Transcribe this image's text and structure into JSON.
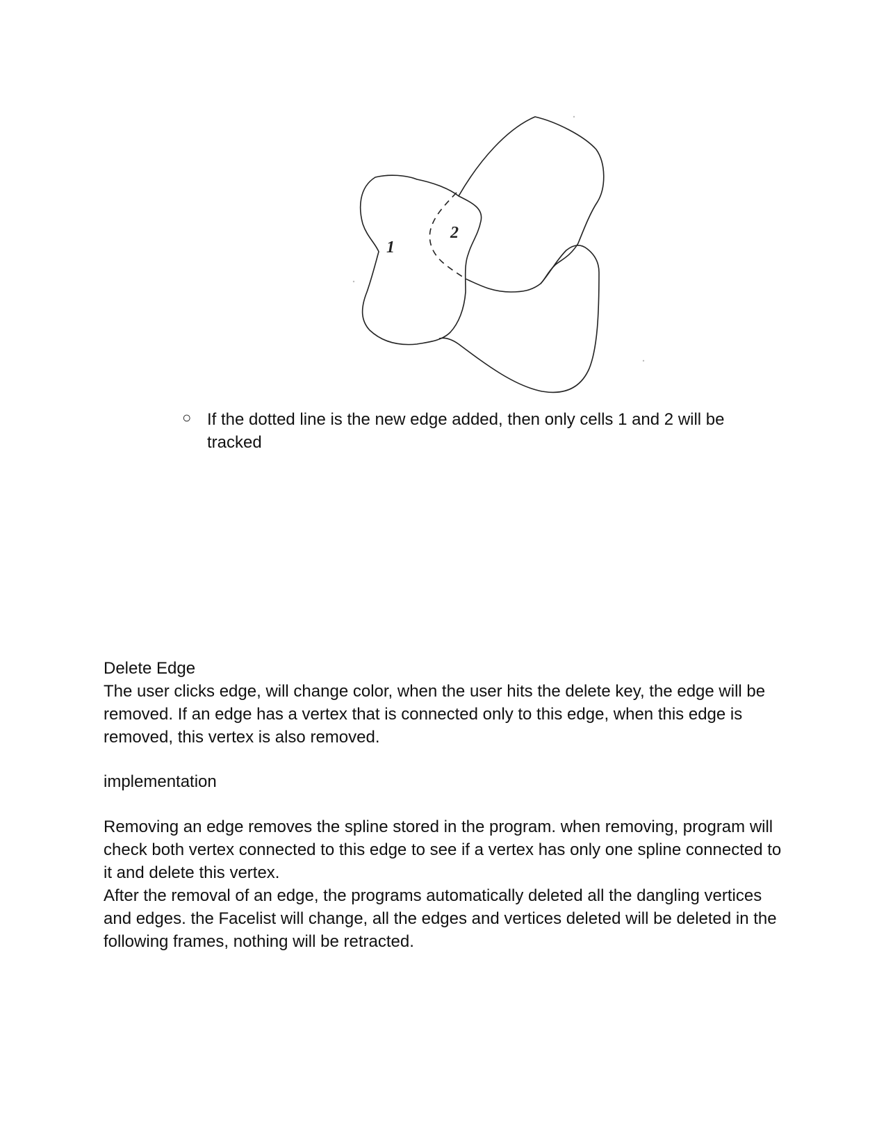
{
  "figure": {
    "cell_1_label": "1",
    "cell_2_label": "2"
  },
  "bullet": {
    "marker": "○",
    "text": "If the dotted line is the new edge added, then only cells 1 and 2 will be tracked"
  },
  "section": {
    "title": "Delete Edge",
    "description": "The user clicks edge, will change color, when the user hits the delete key, the edge will be removed. If an edge has a vertex that is connected only to this edge, when this edge is removed, this vertex is also removed.",
    "subheading": "implementation",
    "impl_paragraph_1": "Removing an edge removes the spline stored in the program. when removing, program will check both vertex connected to this edge to see if a vertex has only one spline connected to it and delete this vertex.",
    "impl_paragraph_2": "After the removal of an edge, the programs automatically deleted all the dangling vertices and edges. the Facelist will change, all the edges and vertices deleted will be deleted in the following frames, nothing will be retracted."
  }
}
